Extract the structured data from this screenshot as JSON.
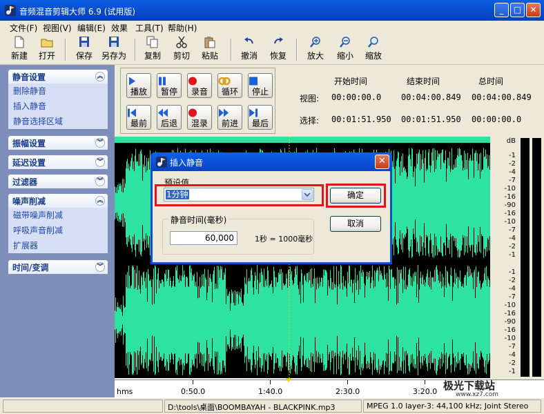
{
  "window": {
    "title": "音频混音剪辑大师 6.9 (试用版)",
    "controls": {
      "minimize": "_",
      "maximize": "□",
      "close": "✕"
    }
  },
  "menu": [
    "文件(F)",
    "视图(V)",
    "编辑(E)",
    "效果",
    "工具(T)",
    "帮助(H)"
  ],
  "toolbar": [
    {
      "label": "新建",
      "icon": "new-file-icon"
    },
    {
      "label": "打开",
      "icon": "open-folder-icon"
    },
    {
      "label": "保存",
      "icon": "save-icon"
    },
    {
      "label": "另存为",
      "icon": "save-as-icon"
    },
    {
      "label": "复制",
      "icon": "copy-icon"
    },
    {
      "label": "剪切",
      "icon": "cut-icon"
    },
    {
      "label": "粘贴",
      "icon": "paste-icon"
    },
    {
      "label": "撤消",
      "icon": "undo-icon"
    },
    {
      "label": "恢复",
      "icon": "redo-icon"
    },
    {
      "label": "放大",
      "icon": "zoom-in-icon"
    },
    {
      "label": "缩小",
      "icon": "zoom-out-icon"
    },
    {
      "label": "缩放",
      "icon": "zoom-icon"
    }
  ],
  "sidebar": {
    "sections": [
      {
        "title": "静音设置",
        "expanded": true,
        "items": [
          "删除静音",
          "插入静音",
          "静音选择区域"
        ]
      },
      {
        "title": "振幅设置",
        "expanded": false,
        "items": []
      },
      {
        "title": "延迟设置",
        "expanded": false,
        "items": []
      },
      {
        "title": "过滤器",
        "expanded": false,
        "items": []
      },
      {
        "title": "噪声削减",
        "expanded": true,
        "items": [
          "磁带噪声削减",
          "呼吸声音削减",
          "扩展器"
        ]
      },
      {
        "title": "时间/变调",
        "expanded": false,
        "items": []
      }
    ]
  },
  "transport": {
    "row1": [
      "播放",
      "暂停",
      "录音",
      "循环",
      "停止"
    ],
    "row2": [
      "最前",
      "后退",
      "混录",
      "前进",
      "最后"
    ]
  },
  "time_info": {
    "headers": [
      "开始时间",
      "结束时间",
      "总时间"
    ],
    "view_label": "视图:",
    "view": [
      "00:00:00.0",
      "00:04:00.849",
      "00:04:00.849"
    ],
    "select_label": "选择:",
    "select": [
      "00:01:51.950",
      "00:01:51.950",
      "00:00:00.0"
    ]
  },
  "db_scale": {
    "unit": "dB",
    "ticks": [
      "-1",
      "-2",
      "-4",
      "-7",
      "-10",
      "-16",
      "-90",
      "-16",
      "-10",
      "-7",
      "-4",
      "-2",
      "-1"
    ]
  },
  "timeline": {
    "unit": "hms",
    "labels": [
      "0:50.0",
      "1:40.0",
      "2:30.0",
      "3:20.0"
    ]
  },
  "status": {
    "left": "",
    "file": "D:\\tools\\桌面\\BOOMBAYAH - BLACKPINK.mp3",
    "format": "MPEG 1.0 layer-3: 44,100 kHz; Joint Stereo"
  },
  "dialog": {
    "title": "插入静音",
    "preset_label": "预设值",
    "preset_value": "1分钟",
    "ok": "确定",
    "cancel": "取消",
    "group_title": "静音时间(毫秒)",
    "duration_value": "60,000",
    "hint": "1秒 = 1000毫秒"
  },
  "watermark": {
    "text": "极光下载站",
    "sub": "www.xz7.com"
  },
  "colors": {
    "wave": "#2ee3a2",
    "highlight": "#e0141c",
    "titlebar": "#0a4fd4"
  }
}
